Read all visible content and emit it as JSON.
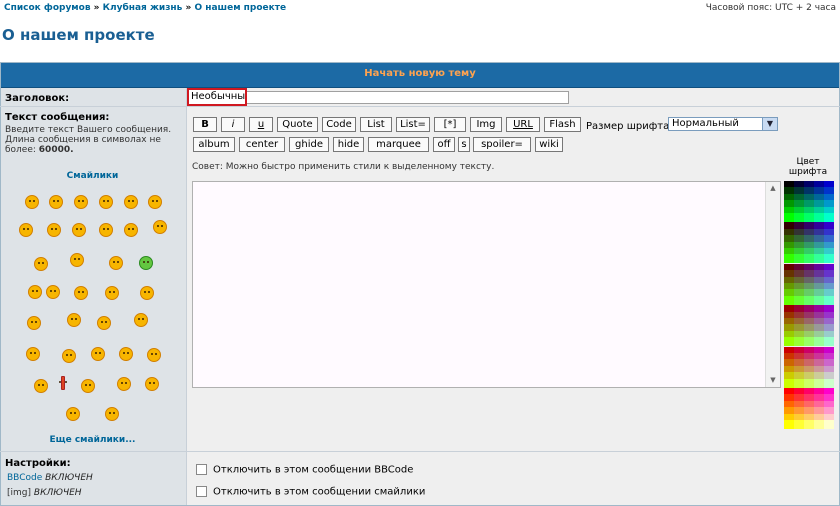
{
  "breadcrumb": [
    "Список форумов",
    "Клубная жизнь",
    "О нашем проекте"
  ],
  "timezone": "Часовой пояс: UTC + 2 часа",
  "page_title": "О нашем проекте",
  "form_header": "Начать новую тему",
  "subject": {
    "label": "Заголовок:",
    "value": "Необычны"
  },
  "message": {
    "label": "Текст сообщения:",
    "desc_lines": [
      "Введите текст Вашего сообщения.",
      "Длина сообщения в символах не",
      "более:"
    ],
    "max_len": "60000.",
    "hint": "Совет: Можно быстро применить стили к выделенному тексту."
  },
  "smilies": {
    "title": "Смайлики",
    "more": "Еще смайлики..."
  },
  "toolbar": {
    "row1": [
      "B",
      "i",
      "u",
      "Quote",
      "Code",
      "List",
      "List=",
      "[*]",
      "Img",
      "URL",
      "Flash"
    ],
    "row2": [
      "album",
      "center",
      "ghide",
      "hide",
      "marquee",
      "off",
      "s",
      "spoiler=",
      "wiki"
    ]
  },
  "font_size": {
    "label": "Размер шрифта:",
    "value": "Нормальный"
  },
  "font_color": {
    "label": "Цвет шрифта"
  },
  "options": [
    "Отключить в этом сообщении BBCode",
    "Отключить в этом сообщении смайлики"
  ],
  "settings": {
    "title": "Настройки:",
    "bbcode": "BBCode",
    "bbcode_state": "ВКЛЮЧЕН",
    "img": "[img]",
    "img_state": "ВКЛЮЧЕН"
  },
  "colors": {
    "header_bg": "#1c6aa5",
    "header_text": "#ffa34f",
    "link": "#006699",
    "highlight": "#d01820"
  }
}
